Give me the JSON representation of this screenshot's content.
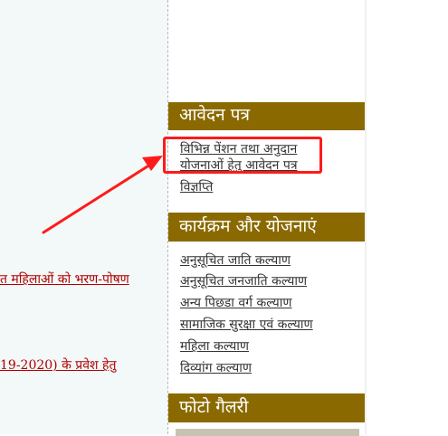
{
  "main": {
    "links": [
      "त महिलाओं को भरण-पोषण",
      "19-2020) के प्रवेश हेतु"
    ]
  },
  "sidebar": {
    "sections": [
      {
        "title": "आवेदन पत्र",
        "items": [
          "विभिन्न पेंशन तथा अनुदान",
          "योजनाओं हेतु आवेदन पत्र",
          "विज्ञप्ति"
        ]
      },
      {
        "title": "कार्यक्रम और योजनाएं",
        "items": [
          "अनुसूचित जाति कल्याण",
          "अनुसूचित जनजाति कल्याण",
          "अन्य पिछडा वर्ग कल्याण",
          "सामाजिक सुरक्षा एवं कल्याण",
          "महिला कल्याण",
          "दिव्यांग कल्याण"
        ]
      },
      {
        "title": "फोटो गैलरी",
        "items": []
      }
    ]
  },
  "colors": {
    "header_bg": "#8a6a00",
    "link_red": "#b00000",
    "annotation_red": "#ff1a1a"
  }
}
